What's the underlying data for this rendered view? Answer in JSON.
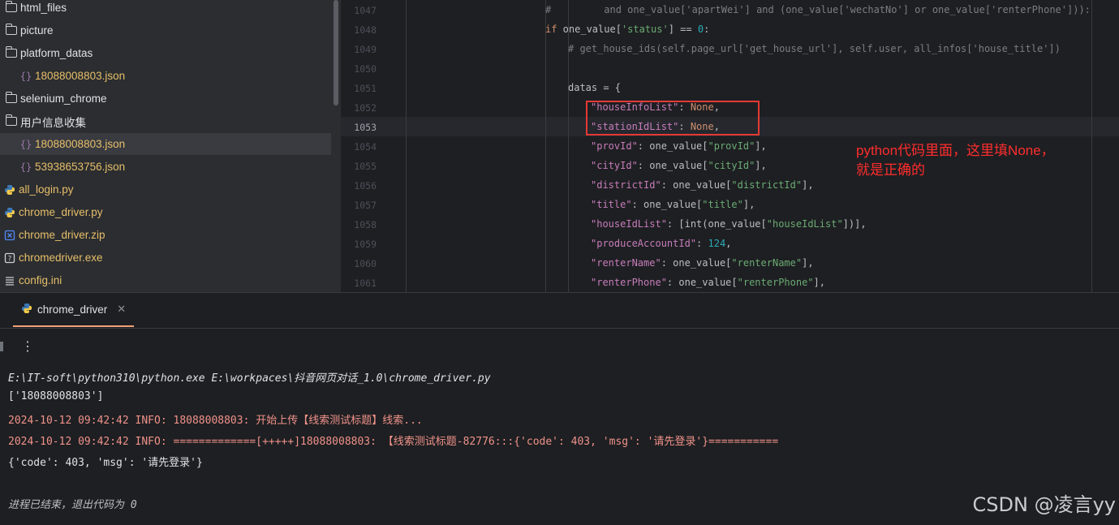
{
  "sidebar": {
    "items": [
      {
        "label": "html_files",
        "type": "folder",
        "indent": 0
      },
      {
        "label": "picture",
        "type": "folder",
        "indent": 0
      },
      {
        "label": "platform_datas",
        "type": "folder",
        "indent": 0
      },
      {
        "label": "18088008803.json",
        "type": "json",
        "indent": 1
      },
      {
        "label": "selenium_chrome",
        "type": "folder",
        "indent": 0
      },
      {
        "label": "用户信息收集",
        "type": "folder",
        "indent": 0
      },
      {
        "label": "18088008803.json",
        "type": "json",
        "indent": 1,
        "selected": true
      },
      {
        "label": "53938653756.json",
        "type": "json",
        "indent": 1
      },
      {
        "label": "all_login.py",
        "type": "python",
        "indent": 0
      },
      {
        "label": "chrome_driver.py",
        "type": "python",
        "indent": 0
      },
      {
        "label": "chrome_driver.zip",
        "type": "zip",
        "indent": 0
      },
      {
        "label": "chromedriver.exe",
        "type": "exe",
        "indent": 0
      },
      {
        "label": "config.ini",
        "type": "ini",
        "indent": 0
      }
    ]
  },
  "editor": {
    "current_line": "1053",
    "lines": [
      {
        "num": "1047",
        "text": "#         and one_value['apartWei'] and (one_value['wechatNo'] or one_value['renterPhone'])):"
      },
      {
        "num": "1048",
        "text": "if one_value['status'] == 0:"
      },
      {
        "num": "1049",
        "text": "# get_house_ids(self.page_url['get_house_url'], self.user, all_infos['house_title'])"
      },
      {
        "num": "1050",
        "text": ""
      },
      {
        "num": "1051",
        "text": "datas = {"
      },
      {
        "num": "1052",
        "text": "\"houseInfoList\": None,"
      },
      {
        "num": "1053",
        "text": "\"stationIdList\": None,"
      },
      {
        "num": "1054",
        "text": "\"provId\": one_value[\"provId\"],"
      },
      {
        "num": "1055",
        "text": "\"cityId\": one_value[\"cityId\"],"
      },
      {
        "num": "1056",
        "text": "\"districtId\": one_value[\"districtId\"],"
      },
      {
        "num": "1057",
        "text": "\"title\": one_value[\"title\"],"
      },
      {
        "num": "1058",
        "text": "\"houseIdList\": [int(one_value[\"houseIdList\"])],"
      },
      {
        "num": "1059",
        "text": "\"produceAccountId\": 124,"
      },
      {
        "num": "1060",
        "text": "\"renterName\": one_value[\"renterName\"],"
      },
      {
        "num": "1061",
        "text": "\"renterPhone\": one_value[\"renterPhone\"],"
      }
    ],
    "annotation_line1": "python代码里面，这里填None，",
    "annotation_line2": "就是正确的"
  },
  "run_panel": {
    "tab_label": "chrome_driver",
    "output": [
      {
        "text": "E:\\IT-soft\\python310\\python.exe E:\\workpaces\\抖音网页对话_1.0\\chrome_driver.py",
        "style": "cmd"
      },
      {
        "text": "['18088008803']",
        "style": "normal"
      },
      {
        "text": "2024-10-12 09:42:42 INFO: 18088008803: 开始上传【线索测试标题】线索...",
        "style": "stderr"
      },
      {
        "text": "2024-10-12 09:42:42 INFO: =============[+++++]18088008803: 【线索测试标题-82776:::{'code': 403, 'msg': '请先登录'}===========",
        "style": "stderr"
      },
      {
        "text": "{'code': 403, 'msg': '请先登录'}",
        "style": "normal"
      },
      {
        "text": "",
        "style": "normal"
      },
      {
        "text": "进程已结束，退出代码为 0",
        "style": "gray"
      }
    ]
  },
  "watermark": "CSDN @凌言yy"
}
